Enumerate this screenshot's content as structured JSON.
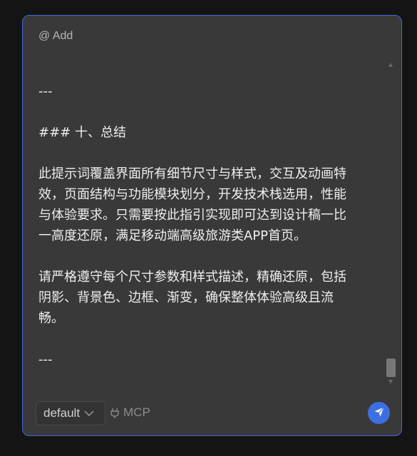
{
  "composer": {
    "mention_placeholder": "@ Add",
    "content_lines": {
      "rule1": "---",
      "heading": "### 十、总结",
      "p1": [
        "此提示词覆盖界面所有细节尺寸与样式，交互及动画特",
        "效，页面结构与功能模块划分，开发技术栈选用，性能",
        "与体验要求。只需要按此指引实现即可达到设计稿一比",
        "一高度还原，满足移动端高级旅游类APP首页。"
      ],
      "p2": [
        "请严格遵守每个尺寸参数和样式描述，精确还原，包括",
        "阴影、背景色、边框、渐变，确保整体体验高级且流",
        "畅。"
      ],
      "rule2": "---"
    },
    "mode_select": {
      "value": "default",
      "icon": "chevron-down-icon"
    },
    "mcp_button": {
      "label": "MCP",
      "icon": "mcp-plug-icon"
    },
    "send_button": {
      "icon": "send-icon"
    }
  },
  "colors": {
    "accent": "#3d6fe0",
    "border_focus": "#3f66d8",
    "panel_bg": "#393939",
    "page_bg": "#141414"
  }
}
